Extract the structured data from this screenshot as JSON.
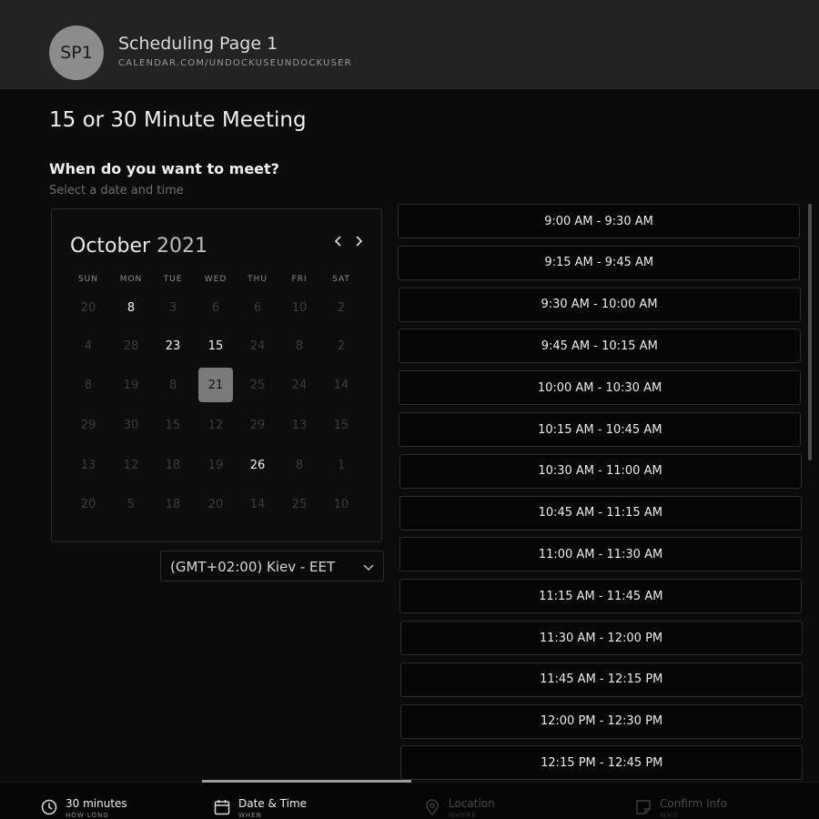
{
  "header": {
    "avatar_initials": "SP1",
    "page_name": "Scheduling Page 1",
    "page_url": "CALENDAR.COM/UNDOCKUSEUNDOCKUSER"
  },
  "meeting": {
    "title": "15 or 30 Minute Meeting",
    "question": "When do you want to meet?",
    "subtitle": "Select a date and time"
  },
  "calendar": {
    "month": "October",
    "year": "2021",
    "weekdays": [
      "SUN",
      "MON",
      "TUE",
      "WED",
      "THU",
      "FRI",
      "SAT"
    ],
    "weeks": [
      [
        {
          "d": "20"
        },
        {
          "d": "8",
          "available": true
        },
        {
          "d": "3"
        },
        {
          "d": "6"
        },
        {
          "d": "6"
        },
        {
          "d": "10"
        },
        {
          "d": "2"
        }
      ],
      [
        {
          "d": "4"
        },
        {
          "d": "28"
        },
        {
          "d": "23",
          "available": true
        },
        {
          "d": "15",
          "available": true
        },
        {
          "d": "24"
        },
        {
          "d": "8"
        },
        {
          "d": "2"
        }
      ],
      [
        {
          "d": "8"
        },
        {
          "d": "19"
        },
        {
          "d": "8"
        },
        {
          "d": "21",
          "available": true,
          "selected": true
        },
        {
          "d": "25"
        },
        {
          "d": "24"
        },
        {
          "d": "14"
        }
      ],
      [
        {
          "d": "29"
        },
        {
          "d": "30"
        },
        {
          "d": "15"
        },
        {
          "d": "12"
        },
        {
          "d": "29"
        },
        {
          "d": "13"
        },
        {
          "d": "15"
        }
      ],
      [
        {
          "d": "13"
        },
        {
          "d": "12"
        },
        {
          "d": "18"
        },
        {
          "d": "19"
        },
        {
          "d": "26",
          "available": true
        },
        {
          "d": "8"
        },
        {
          "d": "1"
        }
      ],
      [
        {
          "d": "20"
        },
        {
          "d": "5"
        },
        {
          "d": "18"
        },
        {
          "d": "20"
        },
        {
          "d": "14"
        },
        {
          "d": "25"
        },
        {
          "d": "10"
        }
      ]
    ]
  },
  "timezone": {
    "selected": "(GMT+02:00) Kiev - EET"
  },
  "slots": [
    "9:00 AM - 9:30 AM",
    "9:15 AM - 9:45 AM",
    "9:30 AM - 10:00 AM",
    "9:45 AM - 10:15 AM",
    "10:00 AM - 10:30 AM",
    "10:15 AM - 10:45 AM",
    "10:30 AM - 11:00 AM",
    "10:45 AM - 11:15 AM",
    "11:00 AM - 11:30 AM",
    "11:15 AM - 11:45 AM",
    "11:30 AM - 12:00 PM",
    "11:45 AM - 12:15 PM",
    "12:00 PM - 12:30 PM",
    "12:15 PM - 12:45 PM"
  ],
  "steps": [
    {
      "label": "30 minutes",
      "sub": "HOW LONG",
      "icon": "clock-icon",
      "state": "done"
    },
    {
      "label": "Date & Time",
      "sub": "WHEN",
      "icon": "calendar-icon",
      "state": "active"
    },
    {
      "label": "Location",
      "sub": "WHERE",
      "icon": "location-pin-icon",
      "state": "future"
    },
    {
      "label": "Confirm Info",
      "sub": "WHO",
      "icon": "note-icon",
      "state": "future"
    }
  ]
}
